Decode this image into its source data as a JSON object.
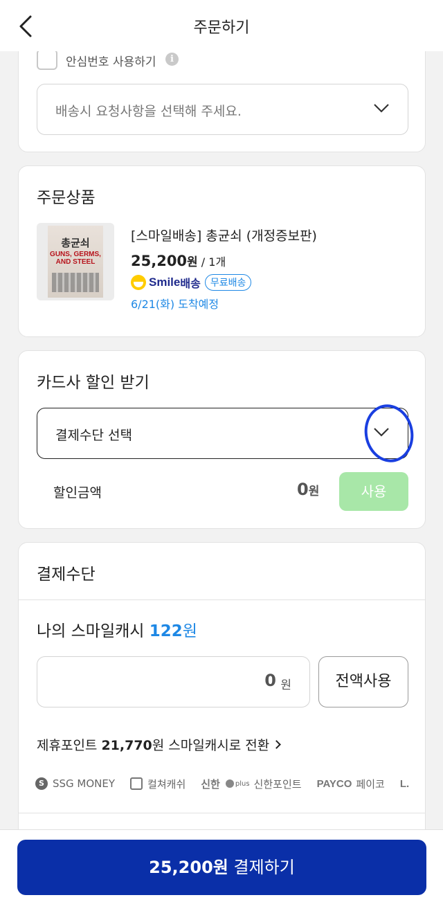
{
  "header": {
    "title": "주문하기"
  },
  "delivery": {
    "safe_number_label": "안심번호 사용하기",
    "info_glyph": "i",
    "request_placeholder": "배송시 요청사항을 선택해 주세요."
  },
  "product_section": {
    "title": "주문상품",
    "book_cover_title": "총균쇠",
    "book_cover_english": "GUNS, GERMS, AND STEEL",
    "name": "[스마일배송] 총균쇠 (개정증보판)",
    "price": "25,200",
    "price_unit": "원",
    "quantity": "/ 1개",
    "smile_word": "Smile",
    "smile_delivery": "배송",
    "free_shipping": "무료배송",
    "arrival": "6/21(화) 도착예정"
  },
  "discount_section": {
    "title": "카드사 할인 받기",
    "payment_select": "결제수단 선택",
    "discount_label": "할인금액",
    "discount_value": "0",
    "discount_unit": "원",
    "use_button": "사용"
  },
  "payment_section": {
    "title": "결제수단",
    "cash_label": "나의 스마일캐시",
    "cash_value": "122",
    "cash_unit": "원",
    "input_value": "0",
    "input_unit": "원",
    "use_all_button": "전액사용",
    "points_prefix": "제휴포인트",
    "points_value": "21,770",
    "points_suffix": "원 스마일캐시로 전환",
    "partners": {
      "ssg_glyph": "S",
      "ssg": "SSG MONEY",
      "culture": "컬쳐캐쉬",
      "shinhan_brand": "신한",
      "shinhan_plus": "plus",
      "shinhan": "신한포인트",
      "payco_brand": "PAYCO",
      "payco": "페이코",
      "l_brand": "L.I"
    }
  },
  "bottom": {
    "amount": "25,200원",
    "label": "결제하기"
  },
  "colors": {
    "primary_button": "#0a2fa8",
    "accent_blue": "#1e88e5",
    "use_button_disabled": "#a8e7a8",
    "highlight_circle": "#1a3fe0",
    "smile_yellow": "#ffcc00"
  },
  "icons": [
    "back-arrow-icon",
    "info-icon",
    "chevron-down-icon",
    "smile-logo-icon",
    "chevron-right-icon",
    "ssg-money-icon",
    "culture-cash-icon"
  ]
}
